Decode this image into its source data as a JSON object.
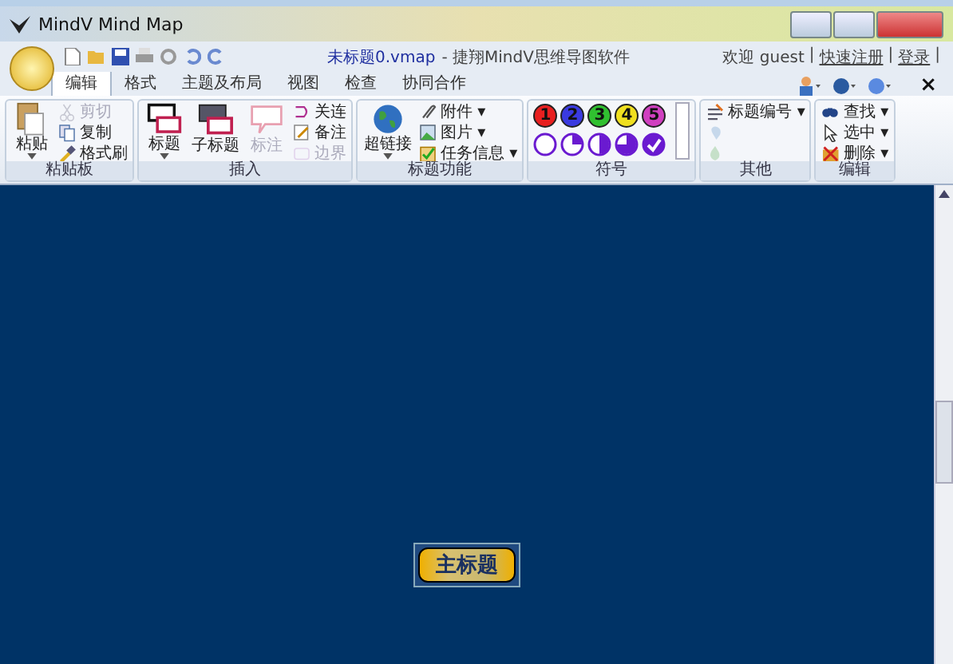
{
  "window": {
    "title": "MindV Mind Map"
  },
  "quick_access": {
    "document": "未标题0.vmap",
    "app": "- 捷翔MindV思维导图软件"
  },
  "account": {
    "welcome": "欢迎 guest",
    "items": [
      {
        "kind": "separator",
        "label": "|"
      },
      {
        "kind": "link",
        "label": "快速注册"
      },
      {
        "kind": "separator",
        "label": "|"
      },
      {
        "kind": "link",
        "label": "登录"
      },
      {
        "kind": "separator",
        "label": "|"
      }
    ]
  },
  "tabs": [
    {
      "label": "编辑",
      "selected": true
    },
    {
      "label": "格式",
      "selected": false
    },
    {
      "label": "主题及布局",
      "selected": false
    },
    {
      "label": "视图",
      "selected": false
    },
    {
      "label": "检查",
      "selected": false
    },
    {
      "label": "协同合作",
      "selected": false
    }
  ],
  "close_label": "×",
  "groups": [
    {
      "title": "粘贴板",
      "items": [
        {
          "kind": "large",
          "label": "粘贴",
          "disabled": false,
          "dropdown": true
        },
        {
          "kind": "small",
          "label": "剪切",
          "disabled": true
        },
        {
          "kind": "small",
          "label": "复制",
          "disabled": false
        },
        {
          "kind": "small",
          "label": "格式刷",
          "disabled": false
        }
      ]
    },
    {
      "title": "插入",
      "items": [
        {
          "kind": "large",
          "label": "标题",
          "disabled": false,
          "dropdown": true
        },
        {
          "kind": "large",
          "label": "子标题",
          "disabled": false,
          "dropdown": false
        },
        {
          "kind": "large",
          "label": "标注",
          "disabled": true,
          "dropdown": false
        },
        {
          "kind": "small",
          "label": "关连",
          "disabled": false
        },
        {
          "kind": "small",
          "label": "备注",
          "disabled": false
        },
        {
          "kind": "small",
          "label": "边界",
          "disabled": true
        }
      ]
    },
    {
      "title": "标题功能",
      "items": [
        {
          "kind": "large",
          "label": "超链接",
          "disabled": false,
          "dropdown": true
        },
        {
          "kind": "small",
          "label": "附件 ▾",
          "disabled": false
        },
        {
          "kind": "small",
          "label": "图片 ▾",
          "disabled": false
        },
        {
          "kind": "small",
          "label": "任务信息 ▾",
          "disabled": false
        }
      ]
    },
    {
      "title": "符号",
      "items": [
        {
          "kind": "symbols"
        }
      ]
    },
    {
      "title": "其他",
      "items": [
        {
          "kind": "small",
          "label": "标题编号 ▾",
          "disabled": false
        },
        {
          "kind": "small",
          "disabled": true
        },
        {
          "kind": "small",
          "disabled": true
        }
      ]
    },
    {
      "title": "编辑",
      "items": [
        {
          "kind": "small",
          "label": "查找 ▾",
          "disabled": false
        },
        {
          "kind": "small",
          "label": "选中 ▾",
          "disabled": false
        },
        {
          "kind": "small",
          "label": "删除 ▾",
          "disabled": false
        }
      ]
    }
  ],
  "symbols": [
    {
      "kind": "number",
      "label": "1",
      "color": "#e82020"
    },
    {
      "kind": "number",
      "label": "2",
      "color": "#3a3ae0"
    },
    {
      "kind": "number",
      "label": "3",
      "color": "#30c030"
    },
    {
      "kind": "number",
      "label": "4",
      "color": "#f0e020"
    },
    {
      "kind": "number",
      "label": "5",
      "color": "#d040c0"
    },
    {
      "kind": "empty"
    },
    {
      "kind": "quarter"
    },
    {
      "kind": "half"
    },
    {
      "kind": "most"
    },
    {
      "kind": "done"
    }
  ],
  "main_topic": {
    "label": "主标题"
  }
}
